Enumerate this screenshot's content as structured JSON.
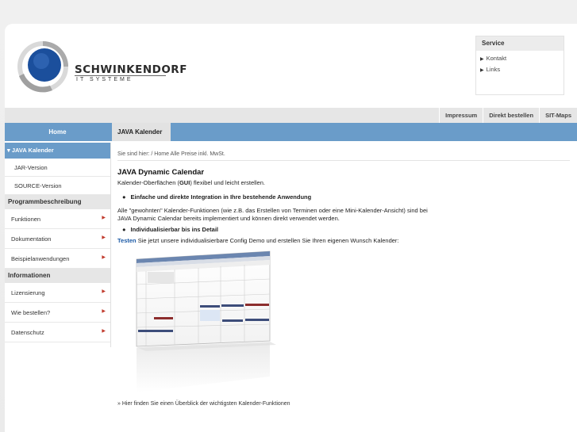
{
  "header": {
    "logo_name": "SCHWINKENDORF",
    "logo_sub": "IT SYSTEME"
  },
  "service": {
    "title": "Service",
    "items": [
      "Kontakt",
      "Links"
    ]
  },
  "topnav": {
    "items": [
      "Impressum",
      "Direkt bestellen",
      "SIT-Maps"
    ]
  },
  "tabs": {
    "home": "Home",
    "active": "JAVA Kalender"
  },
  "sidebar": {
    "active": "▾ JAVA Kalender",
    "sub_items": [
      "JAR-Version",
      "SOURCE-Version"
    ],
    "section1": "Programmbeschreibung",
    "section1_items": [
      "Funktionen",
      "Dokumentation",
      "Beispielanwendungen"
    ],
    "section2": "Informationen",
    "section2_items": [
      "Lizensierung",
      "Wie bestellen?",
      "Datenschutz"
    ]
  },
  "content": {
    "breadcrumb": "Sie sind hier: / Home Alle Preise inkl. MwSt.",
    "title": "JAVA Dynamic Calendar",
    "intro_pre": "Kalender-Oberflächen (",
    "intro_bold": "GUI",
    "intro_post": ") flexibel und leicht erstellen.",
    "bullet1": "Einfache und direkte Integration in Ihre bestehende Anwendung",
    "para2_line1": "Alle \"gewohnten\" Kalender-Funktionen (wie z.B. das Erstellen von Terminen oder eine Mini-Kalender-Ansicht) sind bei",
    "para2_line2": "JAVA Dynamic Calendar bereits implementiert und können direkt verwendet werden.",
    "bullet2": "Individualisierbar bis ins Detail",
    "testen_bold": "Testen",
    "testen_rest": " Sie jetzt unsere individualisierbare Config Demo und erstellen Sie Ihren eigenen Wunsch Kalender:",
    "link1": "» Hier finden Sie einen Überblick der wichtigsten Kalender-Funktionen"
  },
  "colors": {
    "accent": "#6a9cc9",
    "caret": "#c0392b"
  }
}
